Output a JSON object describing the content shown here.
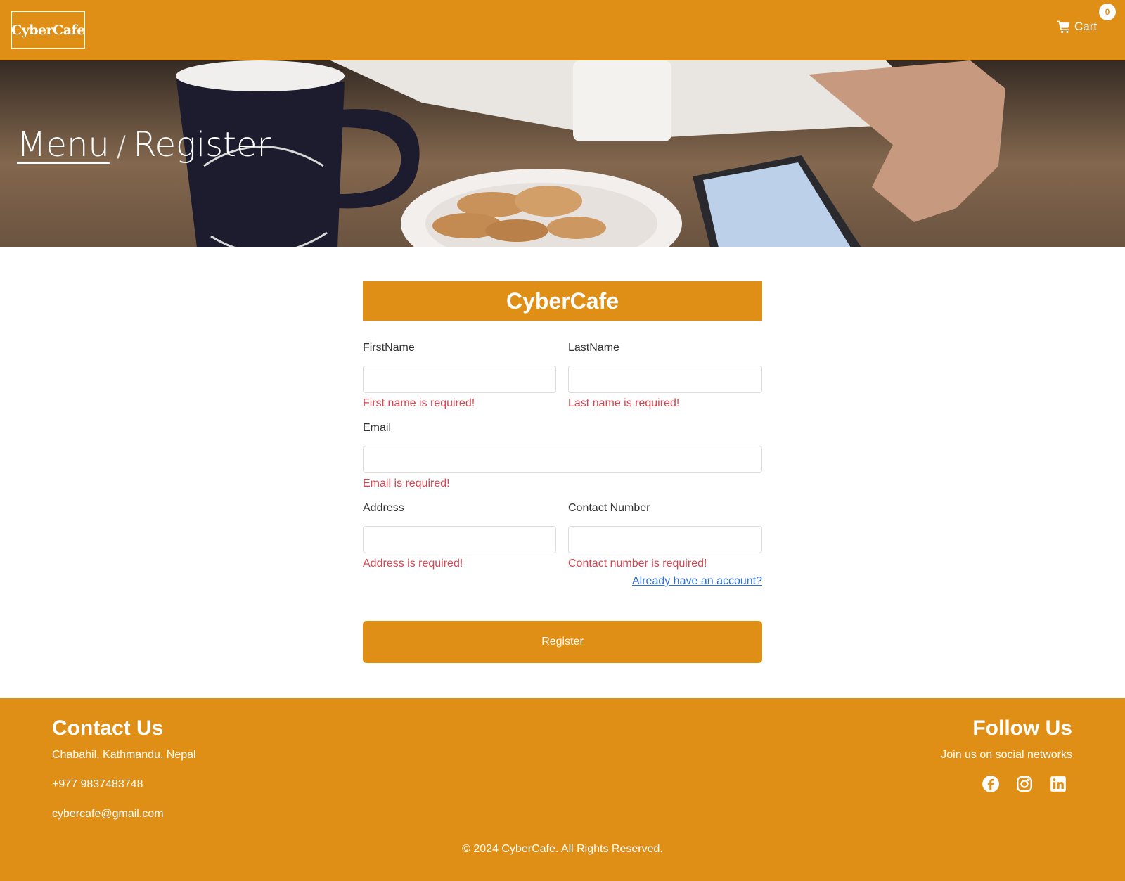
{
  "navbar": {
    "logo_text": "CyberCafe",
    "cart_label": "Cart",
    "cart_count": "0",
    "cart_icon": "shopping-cart-icon"
  },
  "breadcrumb": {
    "menu_link": "Menu",
    "separator": "/",
    "current": "Register"
  },
  "form": {
    "title": "CyberCafe",
    "first_name": {
      "label": "FirstName",
      "value": "",
      "error": "First name is required!"
    },
    "last_name": {
      "label": "LastName",
      "value": "",
      "error": "Last name is required!"
    },
    "email": {
      "label": "Email",
      "value": "",
      "error": "Email is required!"
    },
    "address": {
      "label": "Address",
      "value": "",
      "error": "Address is required!"
    },
    "contact_number": {
      "label": "Contact Number",
      "value": "",
      "error": "Contact number is required!"
    },
    "already_link": "Already have an account?",
    "register_label": "Register"
  },
  "footer": {
    "contact_title": "Contact Us",
    "address": "Chabahil, Kathmandu, Nepal",
    "phone": "+977 9837483748",
    "email": "cybercafe@gmail.com",
    "follow_title": "Follow Us",
    "follow_subtitle": "Join us on social networks",
    "social_icons": [
      "facebook-icon",
      "instagram-icon",
      "linkedin-icon"
    ],
    "copyright": "© 2024 CyberCafe. All Rights Reserved."
  },
  "colors": {
    "accent": "#e08f16",
    "error": "#d64550",
    "link": "#2f6fd3"
  }
}
